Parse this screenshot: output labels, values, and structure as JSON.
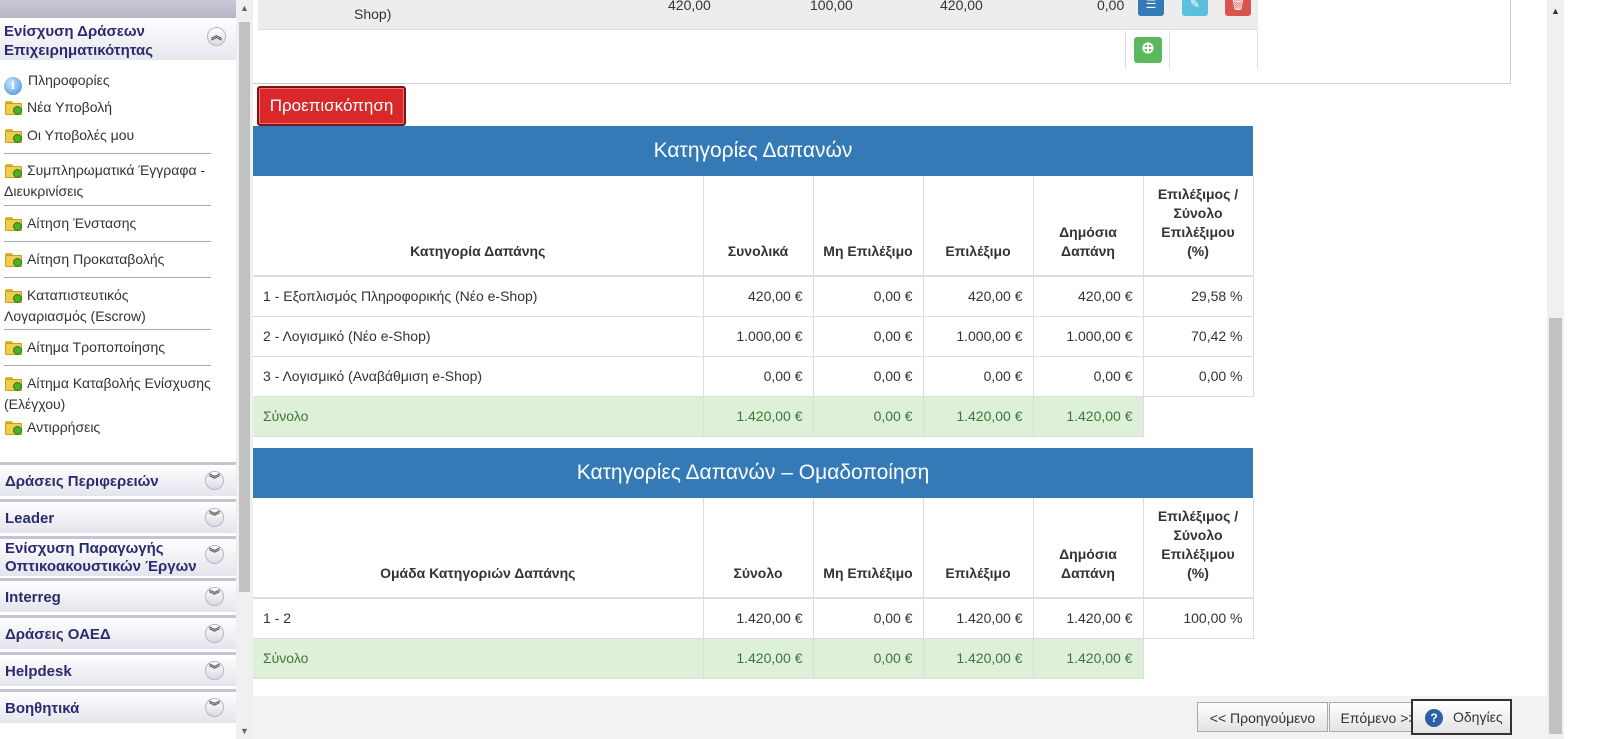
{
  "sidebar": {
    "active_section": "Ενίσχυση Δράσεων Επιχειρηματικότητας",
    "items": [
      {
        "label": "Πληροφορίες",
        "icon": "info-icon"
      },
      {
        "label": "Νέα Υποβολή",
        "icon": "folder-add-icon"
      },
      {
        "label": "Οι Υποβολές μου",
        "icon": "folder-add-icon"
      },
      {
        "label": "Συμπληρωματικά Έγγραφα - Διευκρινίσεις",
        "icon": "folder-add-icon"
      },
      {
        "label": "Αίτηση Ένστασης",
        "icon": "folder-add-icon"
      },
      {
        "label": "Αίτηση Προκαταβολής",
        "icon": "folder-add-icon"
      },
      {
        "label": "Καταπιστευτικός Λογαριασμός (Escrow)",
        "icon": "folder-add-icon"
      },
      {
        "label": "Αίτημα Τροποποίησης",
        "icon": "folder-add-icon"
      },
      {
        "label": "Αίτημα Καταβολής Ενίσχυσης (Ελέγχου)",
        "icon": "folder-add-icon"
      },
      {
        "label": "Αντιρρήσεις",
        "icon": "folder-add-icon"
      }
    ],
    "sections": [
      "Δράσεις Περιφερειών",
      "Leader",
      "Ενίσχυση Παραγωγής Οπτικοακουστικών Έργων",
      "Interreg",
      "Δράσεις ΟΑΕΔ",
      "Helpdesk",
      "Βοηθητικά"
    ]
  },
  "top_row": {
    "desc_fragment": "Shop)",
    "values": [
      "420,00",
      "100,00",
      "420,00",
      "0,00"
    ]
  },
  "preview_button": "Προεπισκόπηση",
  "expense_categories": {
    "title": "Κατηγορίες Δαπανών",
    "headers": [
      "Κατηγορία Δαπάνης",
      "Συνολικά",
      "Μη Επιλέξιμο",
      "Επιλέξιμο",
      "Δημόσια Δαπάνη",
      "Επιλέξιμος / Σύνολο Επιλέξιμου (%)"
    ],
    "rows": [
      [
        "1 - Εξοπλισμός Πληροφορικής (Νέο e-Shop)",
        "420,00 €",
        "0,00 €",
        "420,00 €",
        "420,00 €",
        "29,58 %"
      ],
      [
        "2 - Λογισμικό (Νέο e-Shop)",
        "1.000,00 €",
        "0,00 €",
        "1.000,00 €",
        "1.000,00 €",
        "70,42 %"
      ],
      [
        "3 - Λογισμικό (Αναβάθμιση e-Shop)",
        "0,00 €",
        "0,00 €",
        "0,00 €",
        "0,00 €",
        "0,00 %"
      ]
    ],
    "total": [
      "Σύνολο",
      "1.420,00 €",
      "0,00 €",
      "1.420,00 €",
      "1.420,00 €"
    ]
  },
  "expense_groups": {
    "title": "Κατηγορίες Δαπανών – Ομαδοποίηση",
    "headers": [
      "Ομάδα Κατηγοριών Δαπάνης",
      "Σύνολο",
      "Μη Επιλέξιμο",
      "Επιλέξιμο",
      "Δημόσια Δαπάνη",
      "Επιλέξιμος / Σύνολο Επιλέξιμου (%)"
    ],
    "rows": [
      [
        "1 - 2",
        "1.420,00 €",
        "0,00 €",
        "1.420,00 €",
        "1.420,00 €",
        "100,00 %"
      ]
    ],
    "total": [
      "Σύνολο",
      "1.420,00 €",
      "0,00 €",
      "1.420,00 €",
      "1.420,00 €"
    ]
  },
  "footer": {
    "prev": "<< Προηγούμενο",
    "next": "Επόμενο >>",
    "help": "Οδηγίες"
  },
  "colors": {
    "panel_header": "#337ab7",
    "total_row": "#dff0d8",
    "preview_button": "#d9282a",
    "sidebar_title": "#2b2b72"
  }
}
